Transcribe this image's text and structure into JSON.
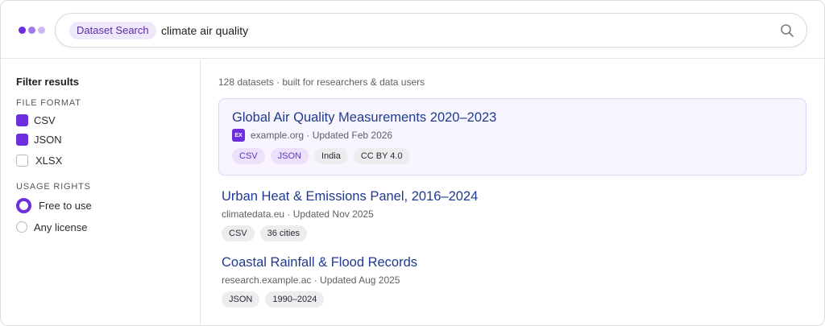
{
  "header": {
    "logo_colors": [
      "#6d2ee0",
      "#9f7ae8",
      "#cdbaf2"
    ],
    "search": {
      "scope_label": "Dataset Search",
      "query": "climate air quality",
      "icon": "search-icon"
    }
  },
  "sidebar": {
    "title": "Filter results",
    "file_format": {
      "label": "FILE FORMAT",
      "options": [
        {
          "label": "CSV",
          "checked": true
        },
        {
          "label": "JSON",
          "checked": true
        },
        {
          "label": "XLSX",
          "checked": false
        }
      ]
    },
    "usage_rights": {
      "label": "USAGE RIGHTS",
      "options": [
        {
          "label": "Free to use",
          "selected": true
        },
        {
          "label": "Any license",
          "selected": false
        }
      ]
    }
  },
  "main": {
    "summary": "128 datasets · built for researchers & data users",
    "results": [
      {
        "title": "Global Air Quality Measurements 2020–2023",
        "favicon_text": "EX",
        "meta": "example.org · Updated Feb 2026",
        "tags": [
          "CSV",
          "JSON",
          "India",
          "CC BY 4.0"
        ]
      },
      {
        "title": "Urban Heat & Emissions Panel, 2016–2024",
        "meta": "climatedata.eu · Updated Nov 2025",
        "tags": [
          "CSV",
          "36 cities"
        ]
      },
      {
        "title": "Coastal Rainfall & Flood Records",
        "meta": "research.example.ac · Updated Aug 2025",
        "tags": [
          "JSON",
          "1990–2024"
        ]
      }
    ]
  },
  "colors": {
    "accent": "#6d2ee0",
    "link": "#1f3a8f"
  }
}
